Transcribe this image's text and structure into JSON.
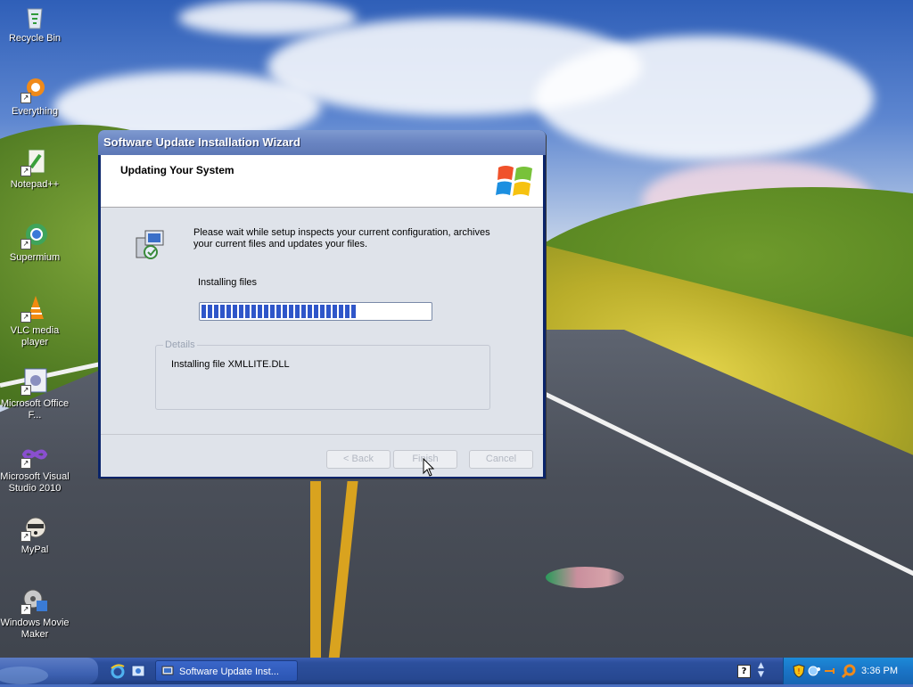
{
  "desktop": {
    "icons": [
      {
        "label": "Recycle Bin"
      },
      {
        "label": "Everything"
      },
      {
        "label": "Notepad++"
      },
      {
        "label": "Supermium"
      },
      {
        "label": "VLC media player"
      },
      {
        "label": "Microsoft Office F..."
      },
      {
        "label": "Microsoft Visual Studio 2010"
      },
      {
        "label": "MyPal"
      },
      {
        "label": "Windows Movie Maker"
      }
    ]
  },
  "wizard": {
    "title": "Software Update Installation Wizard",
    "header_title": "Updating Your System",
    "intro_text": "Please wait while setup inspects your current configuration, archives your current files and updates your files.",
    "status_label": "Installing files",
    "progress_fraction": 0.68,
    "details_legend": "Details",
    "details_text": "Installing file XMLLITE.DLL",
    "buttons": {
      "back": "< Back",
      "finish": "Finish",
      "cancel": "Cancel"
    }
  },
  "taskbar": {
    "task_button_label": "Software Update Inst...",
    "clock": "3:36 PM"
  },
  "icons": {
    "wizard_header": "windows-flag-icon",
    "wizard_body": "setup-computer-icon"
  }
}
